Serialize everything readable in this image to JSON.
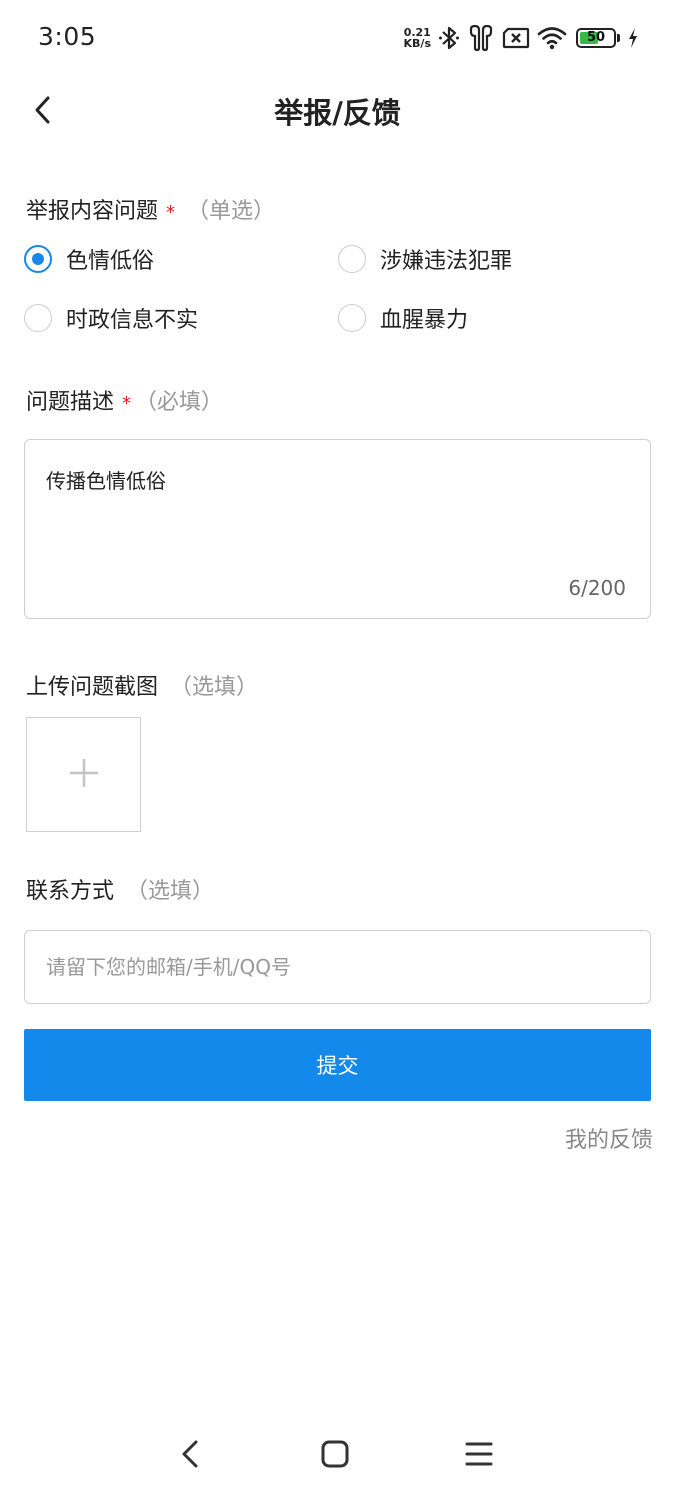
{
  "status_bar": {
    "time": "3:05",
    "net_speed_value": "0.21",
    "net_speed_unit": "KB/s",
    "battery_level": "50",
    "icons": [
      "bluetooth-icon",
      "earbuds-icon",
      "sim-x-icon",
      "wifi-icon",
      "battery-icon",
      "charging-icon"
    ]
  },
  "header": {
    "title": "举报/反馈",
    "back_icon": "chevron-left-icon"
  },
  "report_type": {
    "label": "举报内容问题",
    "required_mark": "*",
    "hint": "（单选）",
    "options": [
      {
        "label": "色情低俗",
        "checked": true
      },
      {
        "label": "涉嫌违法犯罪",
        "checked": false
      },
      {
        "label": "时政信息不实",
        "checked": false
      },
      {
        "label": "血腥暴力",
        "checked": false
      }
    ]
  },
  "description": {
    "label": "问题描述",
    "required_mark": "*",
    "hint": "（必填）",
    "value": "传播色情低俗",
    "counter": "6/200"
  },
  "screenshot_upload": {
    "label": "上传问题截图",
    "hint": "（选填）",
    "add_icon": "plus-icon"
  },
  "contact": {
    "label": "联系方式",
    "hint": "（选填）",
    "placeholder": "请留下您的邮箱/手机/QQ号",
    "value": ""
  },
  "submit_label": "提交",
  "my_feedback_label": "我的反馈",
  "colors": {
    "accent": "#1389ec",
    "radio_checked": "#1a86e8",
    "required": "#e02020",
    "hint": "#999999"
  },
  "nav_bar": {
    "icons": [
      "back-triangle-icon",
      "home-square-icon",
      "menu-lines-icon"
    ]
  }
}
